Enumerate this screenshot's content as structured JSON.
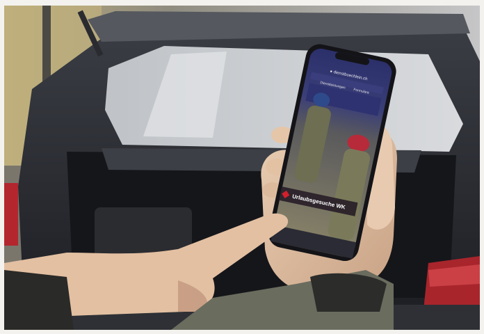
{
  "photo": {
    "subject": "hand-holding-smartphone",
    "phone_screen": {
      "url": "● dienstbuechlein.ch",
      "menu_item_1": "Dienstleistungen",
      "menu_item_2": "Formulare",
      "banner_title": "Urlaubsgesuche WK"
    }
  },
  "colors": {
    "banner_badge": "#d21f2c",
    "screen_header": "#2b2f6a"
  }
}
